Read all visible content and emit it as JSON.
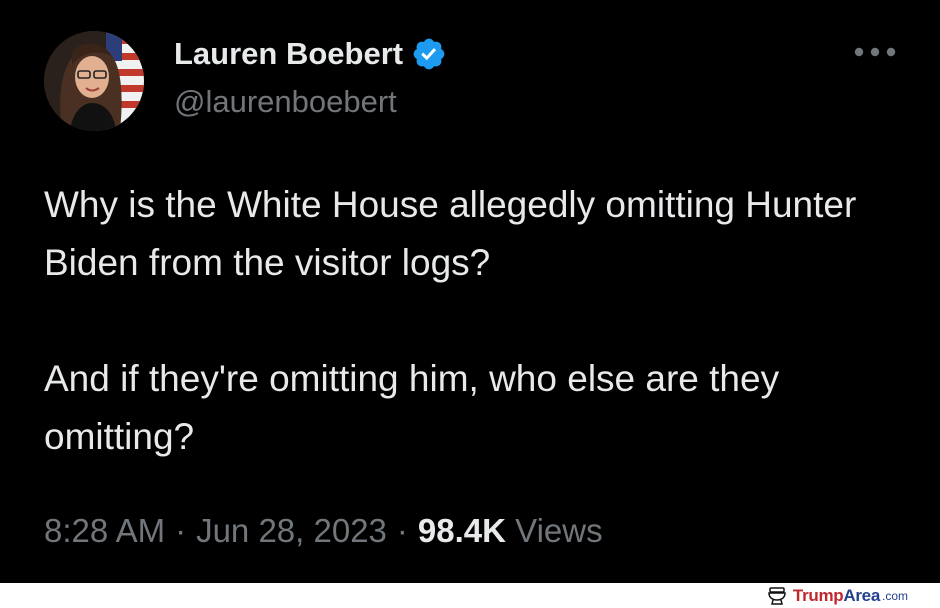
{
  "tweet": {
    "display_name": "Lauren Boebert",
    "handle": "@laurenboebert",
    "verified_icon": "verified-badge-icon",
    "verified_color": "#1d9bf0",
    "more_icon": "more-options-icon",
    "paragraphs": [
      "Why is the White House allegedly omitting Hunter Biden from the visitor logs?",
      "And if they're omitting him, who else are they omitting?"
    ],
    "time": "8:28 AM",
    "separator": "·",
    "date": "Jun 28, 2023",
    "views_count": "98.4K",
    "views_label": "Views"
  },
  "watermark": {
    "brand_part1": "Trump",
    "brand_part2": "Area",
    "tld": ".com",
    "icon": "toilet-icon"
  },
  "colors": {
    "background": "#000000",
    "primary_text": "#e7e9ea",
    "secondary_text": "#71767b",
    "watermark_red": "#c0282d",
    "watermark_blue": "#24408e"
  }
}
